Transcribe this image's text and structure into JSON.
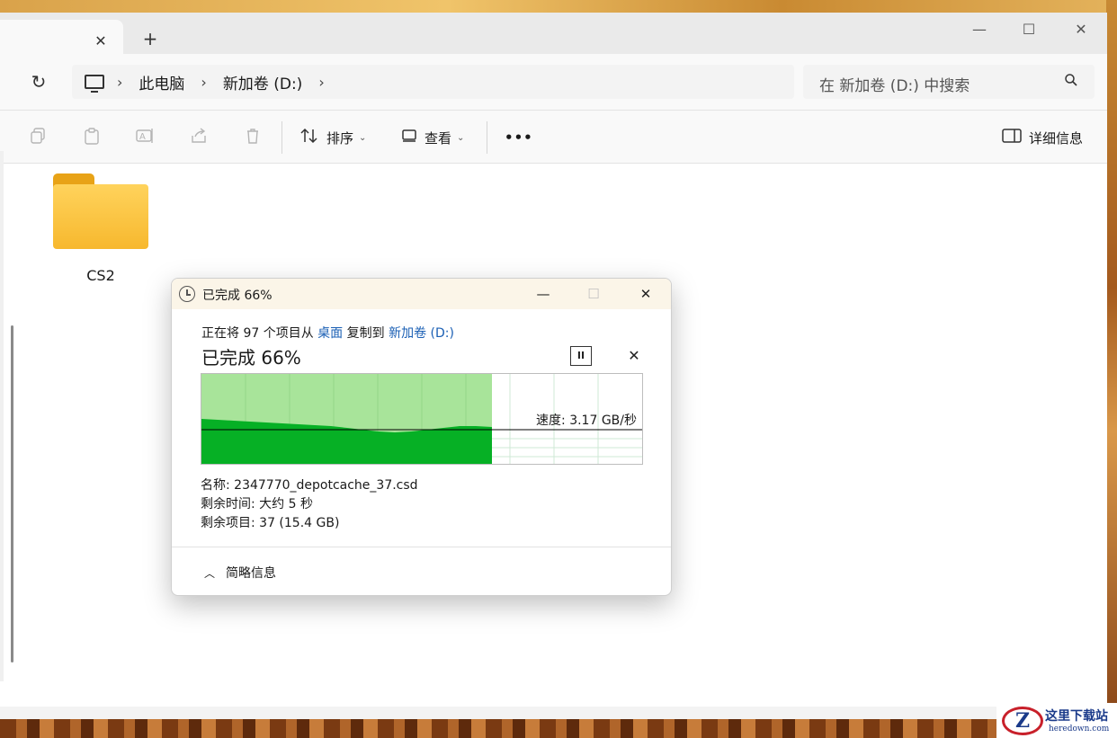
{
  "explorer": {
    "tab_close": "✕",
    "new_tab": "+",
    "window_controls": {
      "minimize": "—",
      "maximize": "☐",
      "close": "✕"
    },
    "refresh_icon": "↻",
    "breadcrumb": [
      "此电脑",
      "新加卷 (D:)"
    ],
    "breadcrumb_chevron": "›",
    "search_placeholder": "在 新加卷 (D:) 中搜索",
    "toolbar": {
      "sort_label": "排序",
      "view_label": "查看",
      "more_label": "•••",
      "details_label": "详细信息"
    },
    "folders": [
      {
        "name": "CS2",
        "color": "#f7b82e"
      }
    ]
  },
  "copy_dialog": {
    "title": "已完成 66%",
    "window_controls": {
      "minimize": "—",
      "maximize": "☐",
      "close": "✕"
    },
    "copy_prefix": "正在将 97 个项目从",
    "source": "桌面",
    "copy_middle": "复制到",
    "destination": "新加卷 (D:)",
    "progress_text": "已完成 66%",
    "progress": 0.66,
    "pause_label": "II",
    "cancel_label": "✕",
    "speed_label": "速度: 3.17 GB/秒",
    "name_line": "名称: 2347770_depotcache_37.csd",
    "time_line": "剩余时间: 大约 5 秒",
    "items_line": "剩余项目: 37 (15.4 GB)",
    "brief_label": "简略信息",
    "brief_icon": "︿",
    "accent_color": "#1a5fb4",
    "graph_fill_color": "#06b025",
    "graph_bg_color": "#a8e49a"
  },
  "watermark": {
    "logo": "Z",
    "text": "这里下载站",
    "url": "heredown.com"
  }
}
